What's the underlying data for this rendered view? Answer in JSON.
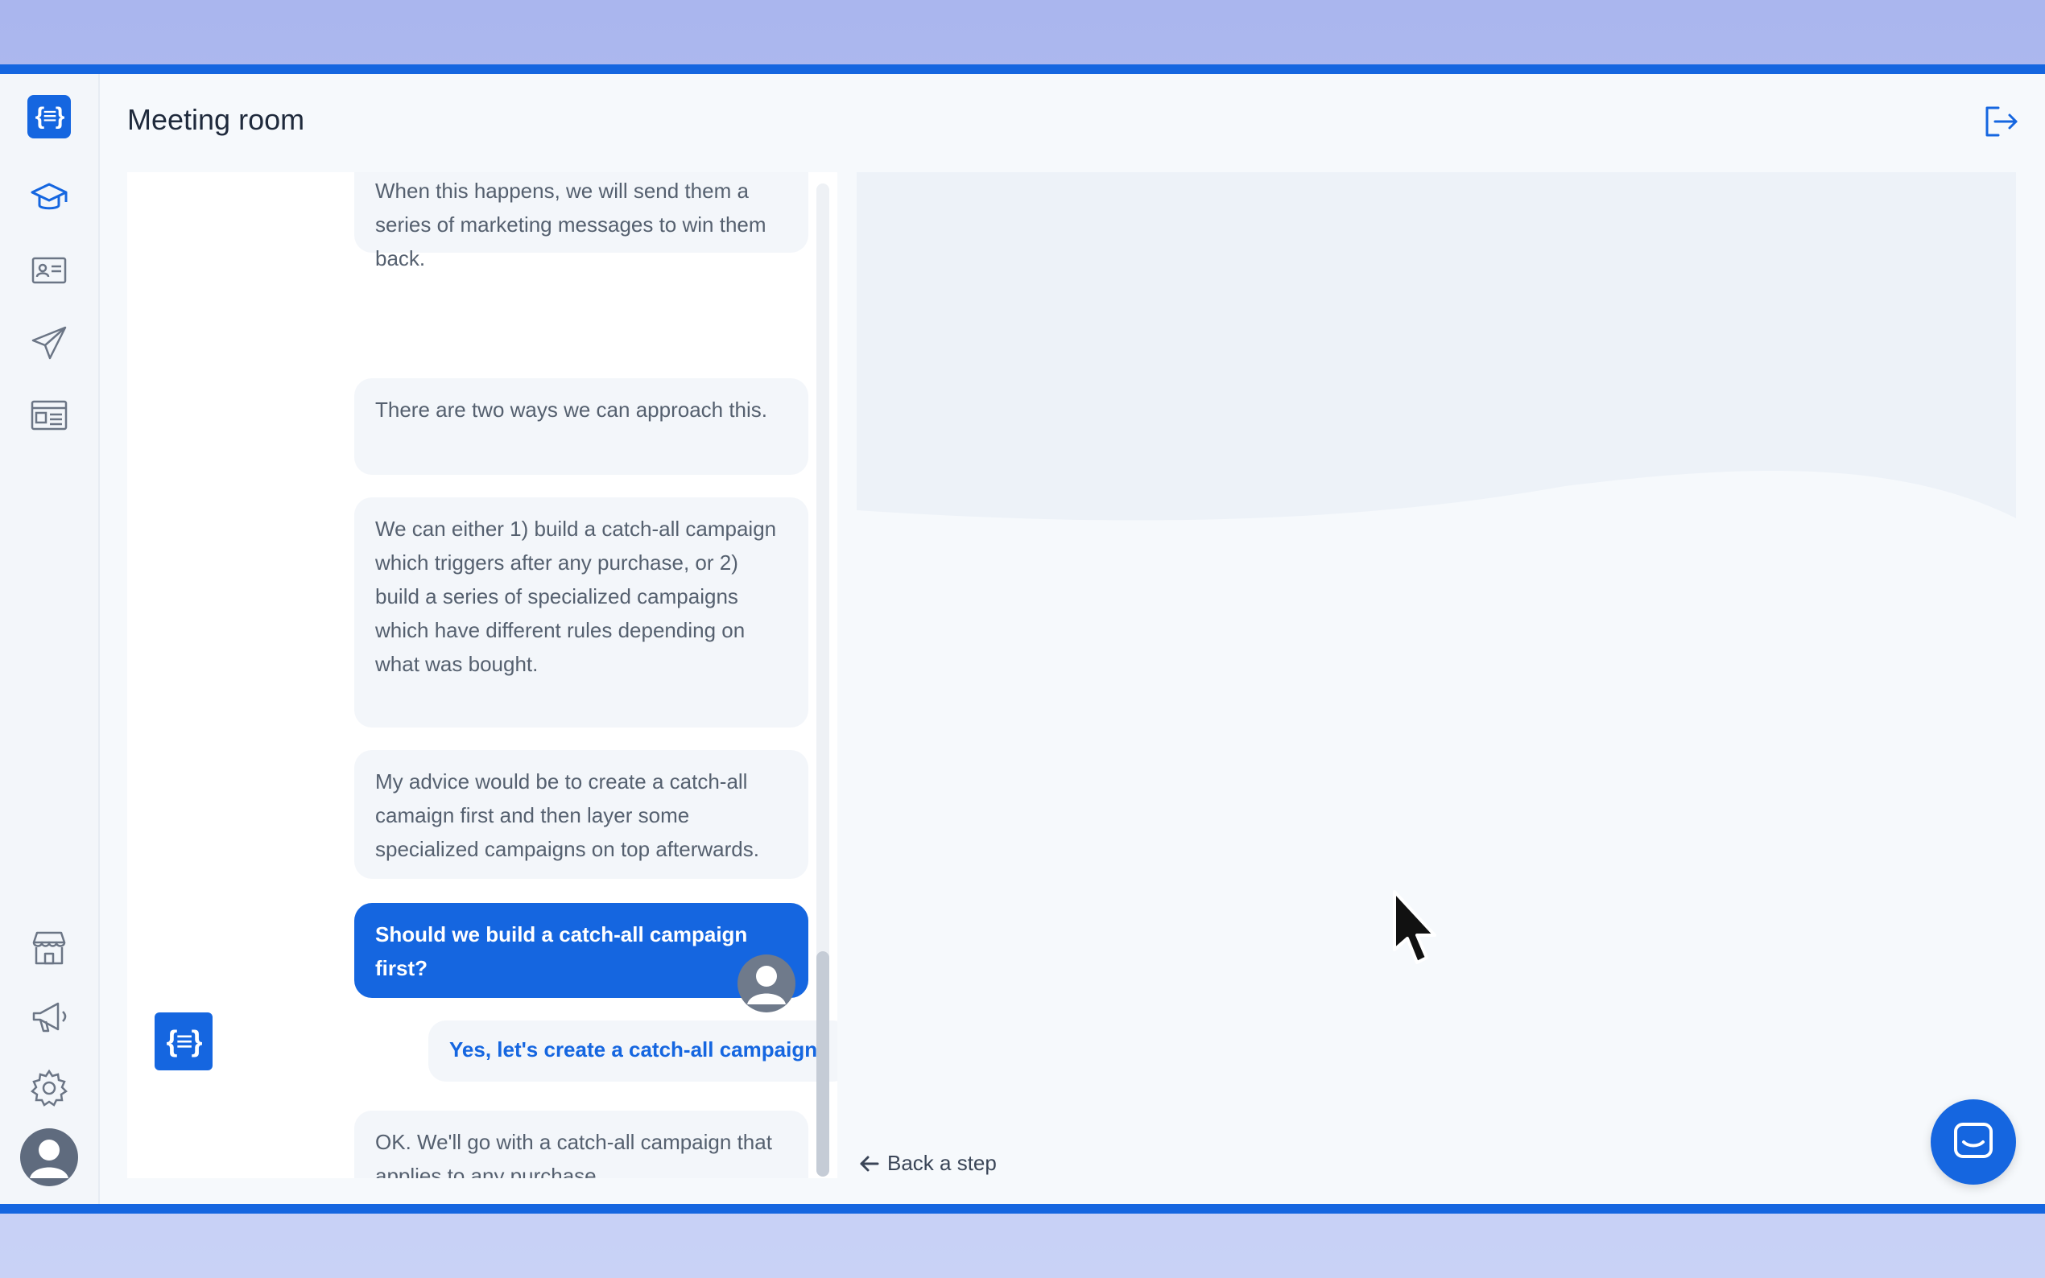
{
  "header": {
    "title": "Meeting room"
  },
  "sidebar": {
    "top_icons": [
      "graduation-cap-icon",
      "contact-card-icon",
      "paper-plane-icon",
      "newsletter-icon"
    ],
    "bottom_icons": [
      "store-icon",
      "megaphone-icon",
      "gear-icon"
    ]
  },
  "chat": {
    "messages": [
      {
        "from": "bot",
        "text": "When this happens, we will send them a series of marketing messages to win them back."
      },
      {
        "from": "bot",
        "text": "There are two ways we can approach this."
      },
      {
        "from": "bot",
        "text": "We can either 1) build a catch-all campaign which triggers after any purchase, or 2) build a series of specialized campaigns which have different rules depending on what was bought."
      },
      {
        "from": "bot",
        "text": "My advice would be to create a catch-all camaign first and then layer some specialized campaigns on top afterwards."
      },
      {
        "from": "bot-question",
        "text": "Should we build a catch-all campaign first?"
      },
      {
        "from": "user",
        "text": "Yes, let's create a catch-all campaign."
      },
      {
        "from": "bot",
        "text": "OK. We'll go with a catch-all campaign that applies to any purchase."
      }
    ]
  },
  "footer": {
    "back_label": "Back a step"
  },
  "colors": {
    "accent": "#1566e0",
    "bubble": "#f3f6fa",
    "background": "#f6f9fc"
  }
}
